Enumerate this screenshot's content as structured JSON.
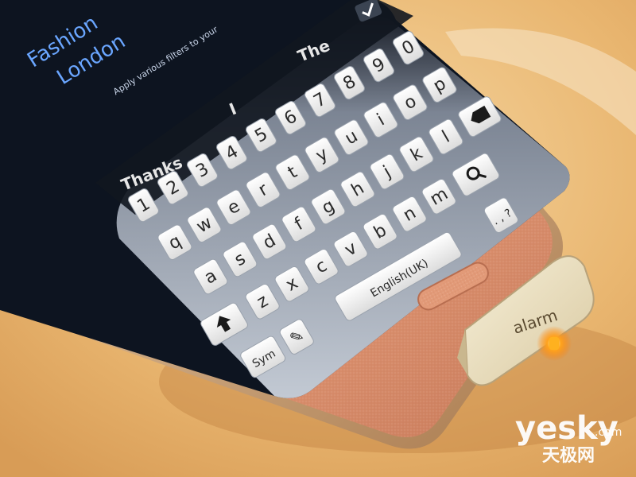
{
  "screen": {
    "top_text_lines": [
      "Fashion",
      "London",
      "Apply various filters to your"
    ],
    "suggestions": [
      "Thanks",
      "I",
      "The"
    ],
    "done_icon": "check-icon"
  },
  "keyboard": {
    "number_row": [
      "1",
      "2",
      "3",
      "4",
      "5",
      "6",
      "7",
      "8",
      "9",
      "0"
    ],
    "row_q": [
      "q",
      "w",
      "e",
      "r",
      "t",
      "y",
      "u",
      "i",
      "o",
      "p"
    ],
    "row_a": [
      "a",
      "s",
      "d",
      "f",
      "g",
      "h",
      "j",
      "k",
      "l"
    ],
    "row_z": [
      "z",
      "x",
      "c",
      "v",
      "b",
      "n",
      "m"
    ],
    "sym_label": "Sym",
    "space_label": "English(UK)",
    "punct_label": ". , ?",
    "icons": {
      "shift": "shift-arrow-icon",
      "handwriting": "handwriting-icon",
      "backspace": "backspace-icon",
      "search": "search-icon"
    }
  },
  "alarm_tag": {
    "label": "alarm"
  },
  "watermark": {
    "text": "yesky",
    "dotcom": ".com",
    "cn": "天极网"
  },
  "colors": {
    "background": "#e8b46a",
    "phone_body": "#e9a07e",
    "phone_frame": "#c9956a",
    "screen_bg": "#0d1420",
    "key_face": "#f3f3f3",
    "led": "#ff9a1a"
  }
}
